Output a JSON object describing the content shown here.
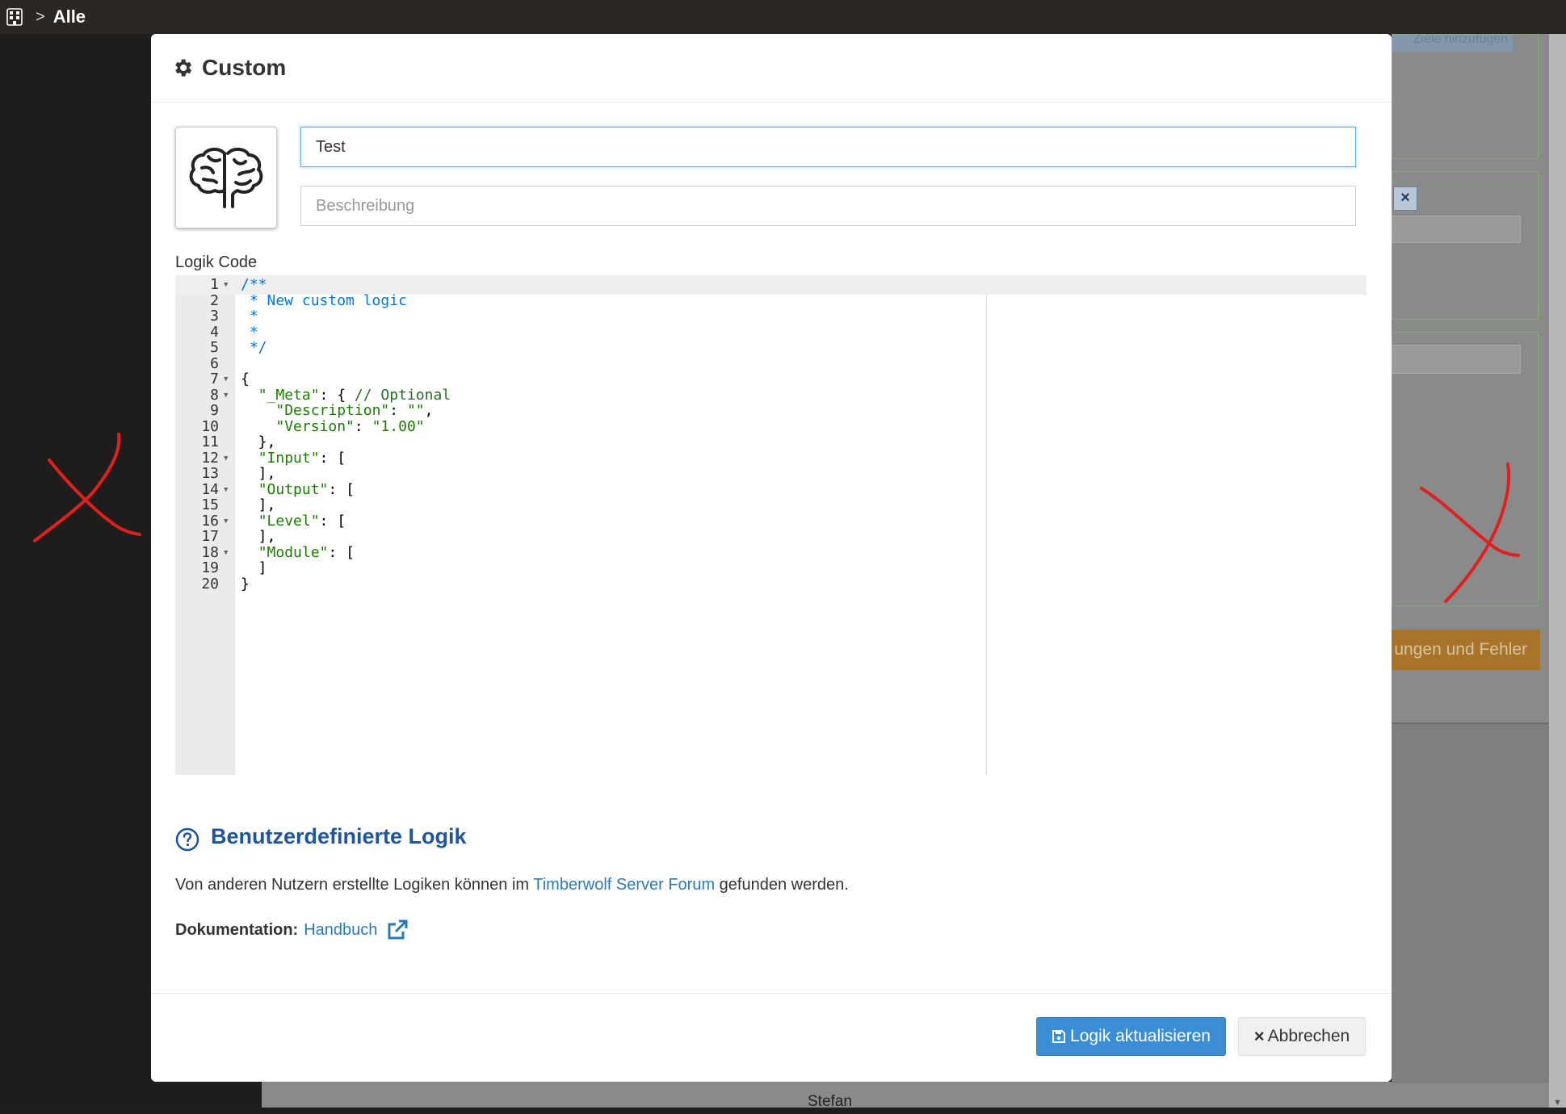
{
  "topbar": {
    "breadcrumb_sep": ">",
    "breadcrumb": "Alle"
  },
  "background": {
    "top_button": "Ziele hinzufügen",
    "chip": "×",
    "orange_button": "ungen und Fehler",
    "bottom_name": "Stefan"
  },
  "dialog": {
    "title": "Custom",
    "name_value": "Test",
    "description_placeholder": "Beschreibung",
    "code_label": "Logik Code",
    "code_lines": [
      {
        "n": "1",
        "fold": true
      },
      {
        "n": "2",
        "fold": false
      },
      {
        "n": "3",
        "fold": false
      },
      {
        "n": "4",
        "fold": false
      },
      {
        "n": "5",
        "fold": false
      },
      {
        "n": "6",
        "fold": false
      },
      {
        "n": "7",
        "fold": true
      },
      {
        "n": "8",
        "fold": true
      },
      {
        "n": "9",
        "fold": false
      },
      {
        "n": "10",
        "fold": false
      },
      {
        "n": "11",
        "fold": false
      },
      {
        "n": "12",
        "fold": true
      },
      {
        "n": "13",
        "fold": false
      },
      {
        "n": "14",
        "fold": true
      },
      {
        "n": "15",
        "fold": false
      },
      {
        "n": "16",
        "fold": true
      },
      {
        "n": "17",
        "fold": false
      },
      {
        "n": "18",
        "fold": true
      },
      {
        "n": "19",
        "fold": false
      },
      {
        "n": "20",
        "fold": false
      }
    ],
    "code": {
      "l1": "/**",
      "l2": " * New custom logic",
      "l3": " *",
      "l4": " *",
      "l5": " */",
      "l7": "{",
      "l8_key": "\"_Meta\"",
      "l8_rest": ": { ",
      "l8_comment": "// Optional",
      "l9_key": "\"Description\"",
      "l9_sep": ": ",
      "l9_val": "\"\"",
      "l9_end": ",",
      "l10_key": "\"Version\"",
      "l10_sep": ": ",
      "l10_val": "\"1.00\"",
      "l11": "  },",
      "l12_key": "\"Input\"",
      "l12_rest": ": [",
      "l13": "  ],",
      "l14_key": "\"Output\"",
      "l14_rest": ": [",
      "l15": "  ],",
      "l16_key": "\"Level\"",
      "l16_rest": ": [",
      "l17": "  ],",
      "l18_key": "\"Module\"",
      "l18_rest": ": [",
      "l19": "  ]",
      "l20": "}"
    },
    "help_title": "Benutzerdefinierte Logik",
    "help_text_before": "Von anderen Nutzern erstellte Logiken können im ",
    "help_link": "Timberwolf Server Forum",
    "help_text_after": " gefunden werden.",
    "doc_label": "Dokumentation:",
    "doc_link": "Handbuch",
    "update_button": "Logik aktualisieren",
    "cancel_button": "Abbrechen",
    "cancel_icon": "×"
  },
  "colors": {
    "primary": "#3b8ed3",
    "title_blue": "#1f55a0",
    "link": "#2a7ab8",
    "annotation_red": "#e02020"
  }
}
